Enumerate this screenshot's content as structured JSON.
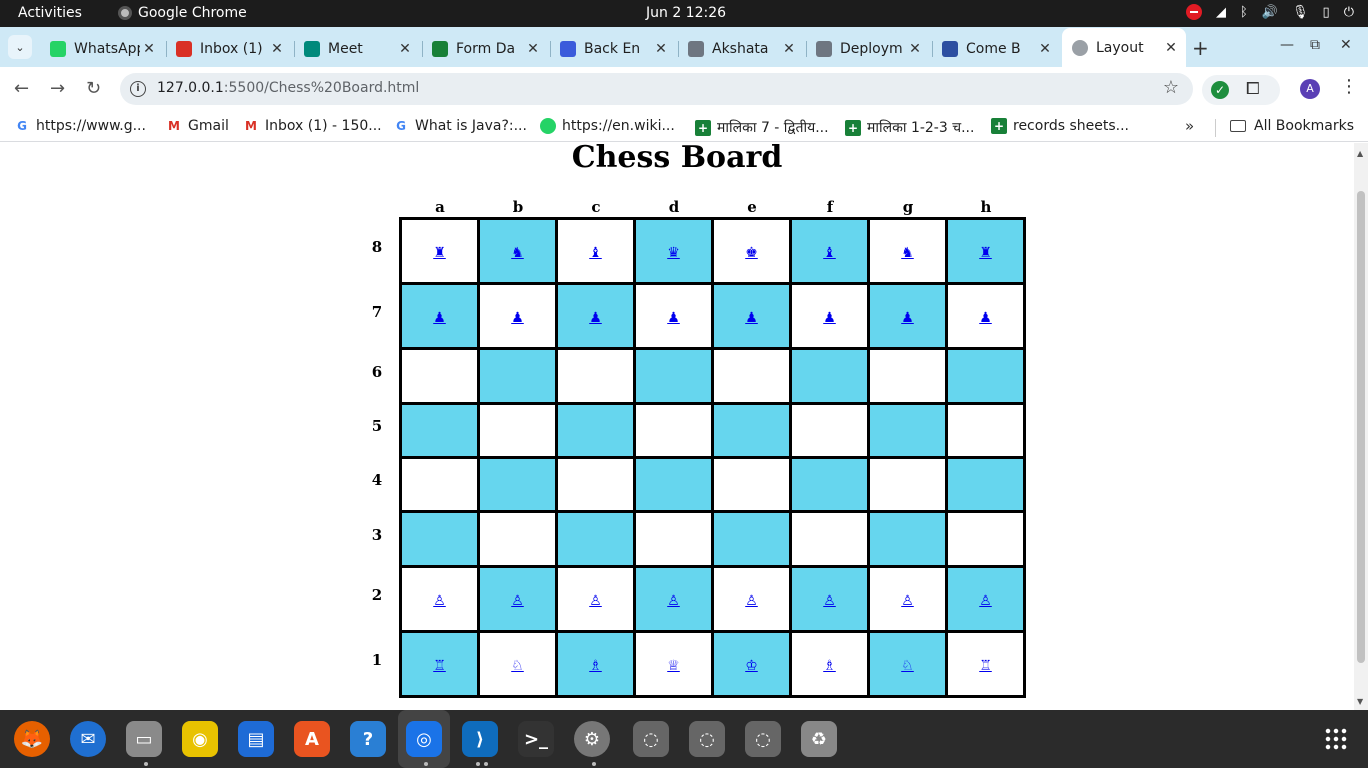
{
  "system": {
    "activities": "Activities",
    "app_name": "Google Chrome",
    "clock": "Jun 2  12:26"
  },
  "tabs": [
    {
      "title": "WhatsApp",
      "icon": "whatsapp-icon",
      "color": "#25d366"
    },
    {
      "title": "Inbox (1)",
      "icon": "gmail-icon",
      "color": "#d93025"
    },
    {
      "title": "Meet",
      "icon": "meet-icon",
      "color": "#00897b"
    },
    {
      "title": "Form Da",
      "icon": "sheets-icon",
      "color": "#188038"
    },
    {
      "title": "Back En",
      "icon": "printer-icon",
      "color": "#3b5bdb"
    },
    {
      "title": "Akshata",
      "icon": "github-icon",
      "color": "#6e7681"
    },
    {
      "title": "Deploym",
      "icon": "github-icon",
      "color": "#6e7681"
    },
    {
      "title": "Come B",
      "icon": "replit-icon",
      "color": "#2d4fa1"
    },
    {
      "title": "Layout",
      "icon": "globe-icon",
      "color": "#9aa0a6"
    }
  ],
  "omnibox": {
    "host": "127.0.0.1",
    "path": ":5500/Chess%20Board.html"
  },
  "profile": {
    "initial": "A"
  },
  "bookmarks": [
    {
      "label": "https://www.g...",
      "icon": "google-icon",
      "color": "#4285f4"
    },
    {
      "label": "Gmail",
      "icon": "gmail-icon",
      "color": "#d93025"
    },
    {
      "label": "Inbox (1) - 150...",
      "icon": "gmail-icon",
      "color": "#d93025"
    },
    {
      "label": "What is Java?:...",
      "icon": "google-icon",
      "color": "#4285f4"
    },
    {
      "label": "https://en.wiki...",
      "icon": "whatsapp-icon",
      "color": "#25d366"
    },
    {
      "label": "मालिका 7 - द्वितीय...",
      "icon": "sheets-icon",
      "color": "#188038"
    },
    {
      "label": "मालिका 1-2-3 च...",
      "icon": "sheets-icon",
      "color": "#188038"
    },
    {
      "label": "records sheets...",
      "icon": "sheets-icon",
      "color": "#188038"
    }
  ],
  "all_bookmarks": "All Bookmarks",
  "page": {
    "title": "Chess Board",
    "files": [
      "a",
      "b",
      "c",
      "d",
      "e",
      "f",
      "g",
      "h"
    ],
    "colors": {
      "light": "#ffffff",
      "dark": "#66d6ee",
      "piece_link": "#0000ee"
    },
    "ranks": [
      {
        "label": "8",
        "pieces": [
          "♜",
          "♞",
          "♝",
          "♛",
          "♚",
          "♝",
          "♞",
          "♜"
        ]
      },
      {
        "label": "7",
        "pieces": [
          "♟",
          "♟",
          "♟",
          "♟",
          "♟",
          "♟",
          "♟",
          "♟"
        ]
      },
      {
        "label": "6",
        "pieces": [
          "",
          "",
          "",
          "",
          "",
          "",
          "",
          ""
        ]
      },
      {
        "label": "5",
        "pieces": [
          "",
          "",
          "",
          "",
          "",
          "",
          "",
          ""
        ]
      },
      {
        "label": "4",
        "pieces": [
          "",
          "",
          "",
          "",
          "",
          "",
          "",
          ""
        ]
      },
      {
        "label": "3",
        "pieces": [
          "",
          "",
          "",
          "",
          "",
          "",
          "",
          ""
        ]
      },
      {
        "label": "2",
        "pieces": [
          "♙",
          "♙",
          "♙",
          "♙",
          "♙",
          "♙",
          "♙",
          "♙"
        ]
      },
      {
        "label": "1",
        "pieces": [
          "♖",
          "♘",
          "♗",
          "♕",
          "♔",
          "♗",
          "♘",
          "♖"
        ]
      }
    ]
  },
  "dock": [
    {
      "name": "firefox-icon",
      "color": "#e66000",
      "glyph": "🦊"
    },
    {
      "name": "thunderbird-icon",
      "color": "#1f6fd1",
      "glyph": "✉"
    },
    {
      "name": "files-icon",
      "color": "#8a8a8a",
      "glyph": "▭"
    },
    {
      "name": "rhythmbox-icon",
      "color": "#e8c200",
      "glyph": "◉"
    },
    {
      "name": "writer-icon",
      "color": "#1e6bd6",
      "glyph": "▤"
    },
    {
      "name": "app-center-icon",
      "color": "#e95420",
      "glyph": "A"
    },
    {
      "name": "help-icon",
      "color": "#2a7fd4",
      "glyph": "?"
    },
    {
      "name": "chrome-icon",
      "color": "#1a73e8",
      "glyph": "◎"
    },
    {
      "name": "vscode-icon",
      "color": "#0f6cbd",
      "glyph": "⟩"
    },
    {
      "name": "terminal-icon",
      "color": "#333333",
      "glyph": ">_"
    },
    {
      "name": "settings-icon",
      "color": "#777777",
      "glyph": "⚙"
    },
    {
      "name": "disc-icon",
      "color": "#666666",
      "glyph": "◌"
    },
    {
      "name": "disc-icon",
      "color": "#666666",
      "glyph": "◌"
    },
    {
      "name": "disc-icon",
      "color": "#666666",
      "glyph": "◌"
    },
    {
      "name": "trash-icon",
      "color": "#888888",
      "glyph": "♻"
    }
  ]
}
